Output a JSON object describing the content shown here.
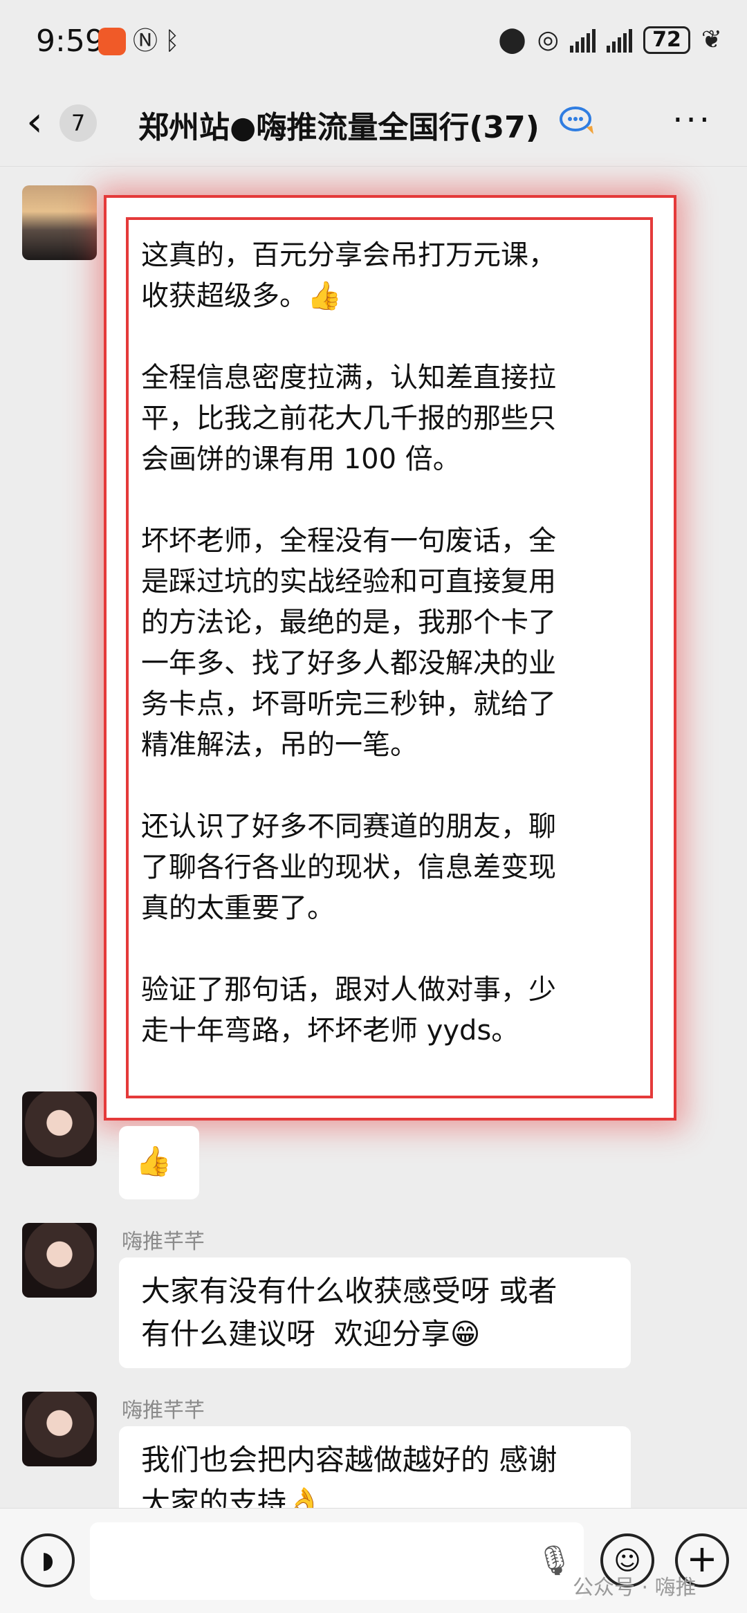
{
  "status_bar": {
    "time": "9:59",
    "battery": "72",
    "icons": [
      "app-notification-icon",
      "nfc-icon",
      "bluetooth-icon",
      "location-icon",
      "hotspot-icon",
      "signal-icon",
      "signal-icon",
      "leaf-icon"
    ]
  },
  "nav": {
    "unread_count": "7",
    "title": "郑州站●嗨推流量全国行(37)"
  },
  "messages": [
    {
      "sender": "",
      "text": "这真的，百元分享会吊打万元课，\n收获超级多。👍\n\n全程信息密度拉满，认知差直接拉\n平，比我之前花大几千报的那些只\n会画饼的课有用 100 倍。\n\n坏坏老师，全程没有一句废话，全\n是踩过坑的实战经验和可直接复用\n的方法论，最绝的是，我那个卡了\n一年多、找了好多人都没解决的业\n务卡点，坏哥听完三秒钟，就给了\n精准解法，吊的一笔。\n\n还认识了好多不同赛道的朋友，聊\n了聊各行各业的现状，信息差变现\n真的太重要了。\n\n验证了那句话，跟对人做对事，少\n走十年弯路，坏坏老师 yyds。"
    },
    {
      "sender": "",
      "text": "👍"
    },
    {
      "sender": "嗨推芊芊",
      "text": "大家有没有什么收获感受呀 或者\n有什么建议呀  欢迎分享😁"
    },
    {
      "sender": "嗨推芊芊",
      "text": "我们也会把内容越做越好的 感谢\n大家的支持👌"
    }
  ],
  "input_bar": {
    "placeholder": "",
    "watermark": "公众号 · 嗨推"
  },
  "colors": {
    "highlight": "#e43a3a",
    "background": "#ededed",
    "bubble": "#ffffff"
  }
}
